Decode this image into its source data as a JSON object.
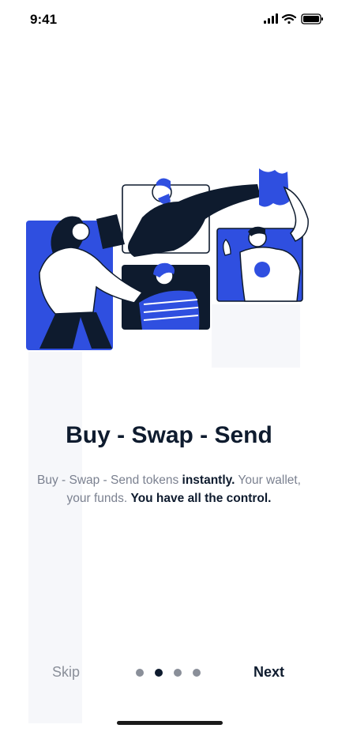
{
  "status": {
    "time": "9:41"
  },
  "onboarding": {
    "title": "Buy - Swap - Send",
    "desc_part1": "Buy - Swap - Send tokens ",
    "desc_bold1": "instantly.",
    "desc_part2": " Your wallet, your funds. ",
    "desc_bold2": "You have all the control."
  },
  "footer": {
    "skip_label": "Skip",
    "next_label": "Next",
    "page_count": 4,
    "active_page": 2
  },
  "colors": {
    "accent": "#2f4fe0",
    "text_dark": "#0e1b2e",
    "text_muted": "#7b8190"
  },
  "icons": [
    "signal-icon",
    "wifi-icon",
    "battery-icon"
  ]
}
